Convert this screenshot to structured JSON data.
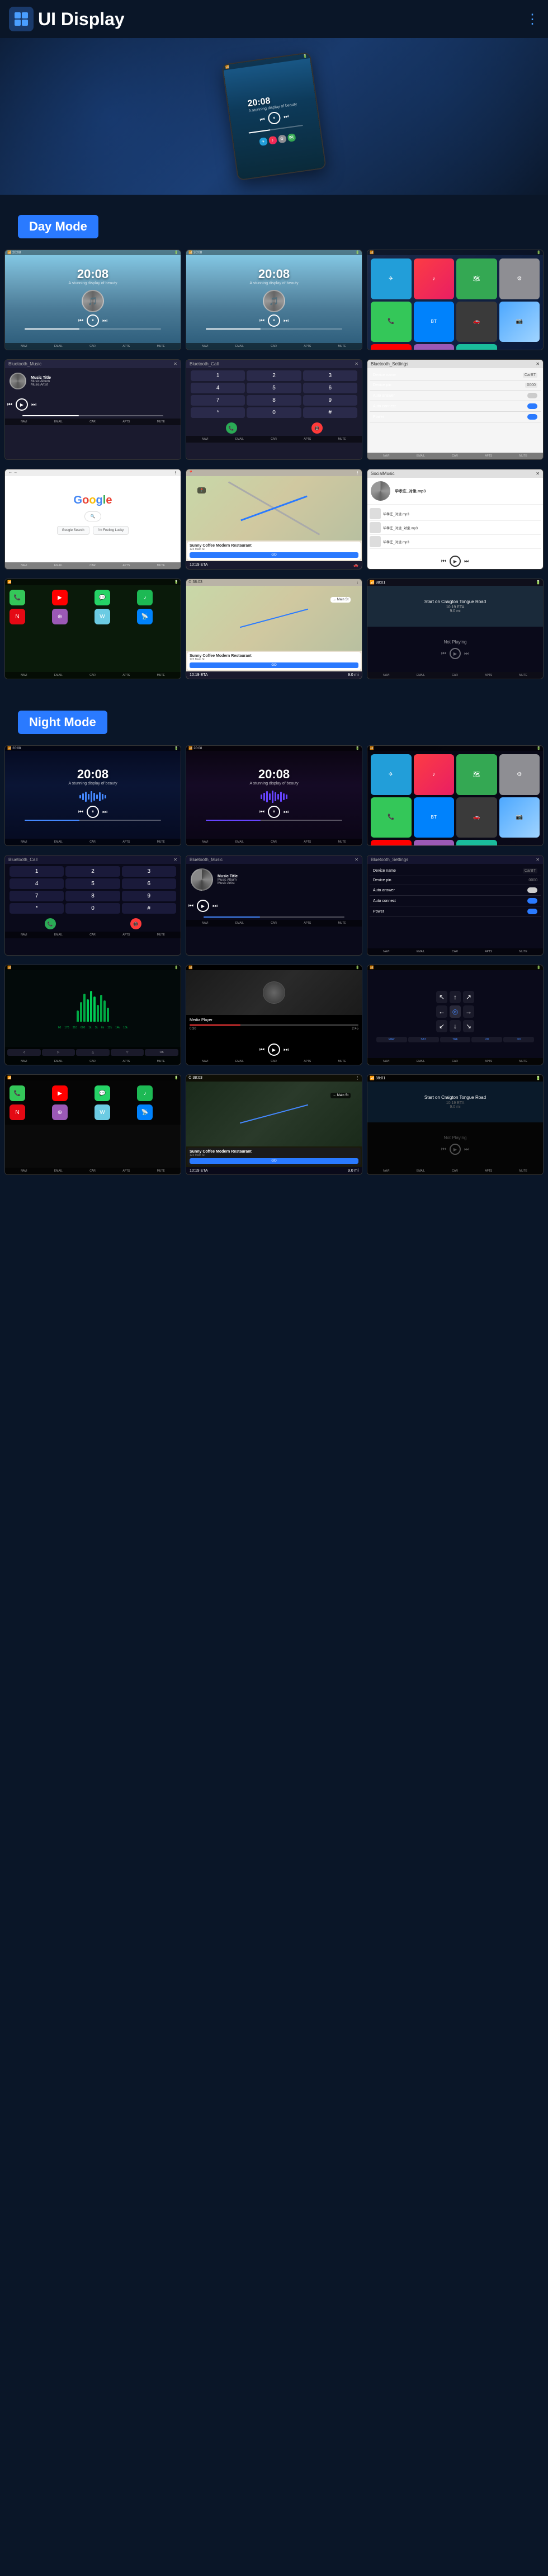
{
  "app": {
    "title": "UI Display",
    "menu_icon": "≡",
    "hamburger": "☰",
    "dots_icon": "⋮"
  },
  "sections": {
    "day_mode": "Day Mode",
    "night_mode": "Night Mode"
  },
  "music_player": {
    "time": "20:08",
    "subtitle": "A stunning display of beauty",
    "track_title": "Music Title",
    "track_album": "Music Album",
    "track_artist": "Music Artist",
    "play_icon": "▶",
    "pause_icon": "⏸",
    "prev_icon": "⏮",
    "next_icon": "⏭",
    "shuffle": "⇄",
    "repeat": "↺"
  },
  "bluetooth": {
    "call_label": "Bluetooth_Call",
    "music_label": "Bluetooth_Music",
    "settings_label": "Bluetooth_Settings"
  },
  "settings": {
    "device_name_label": "Device name",
    "device_name_value": "CarBT",
    "device_pin_label": "Device pin",
    "device_pin_value": "0000",
    "auto_answer_label": "Auto answer",
    "auto_connect_label": "Auto connect",
    "power_label": "Power"
  },
  "navigation": {
    "eta_label": "10:19 ETA",
    "distance_label": "9.0 mi",
    "street_label": "Start on Craigton Tongue Road",
    "restaurant_name": "Sunny Coffee Modern Restaurant",
    "restaurant_address": "123 Main St",
    "go_button": "GO"
  },
  "not_playing": {
    "label": "Not Playing"
  },
  "call_buttons": {
    "nums": [
      "1",
      "2",
      "3",
      "4",
      "5",
      "6",
      "7",
      "8",
      "9",
      "*",
      "0",
      "#"
    ]
  },
  "dock_items": [
    "NAVI",
    "EMAIL",
    "CAR",
    "APTS",
    "MUTE"
  ]
}
